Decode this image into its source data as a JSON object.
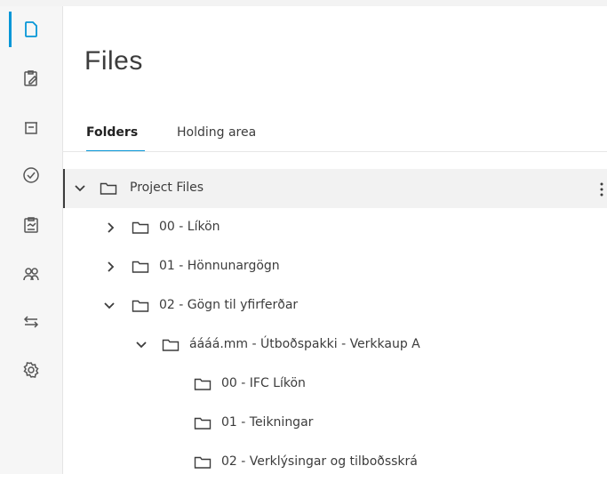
{
  "page": {
    "title": "Files"
  },
  "rail": {
    "items": [
      {
        "icon": "document-icon",
        "active": true
      },
      {
        "icon": "clipboard-edit-icon",
        "active": false
      },
      {
        "icon": "archive-box-icon",
        "active": false
      },
      {
        "icon": "check-circle-icon",
        "active": false
      },
      {
        "icon": "report-clipboard-icon",
        "active": false
      },
      {
        "icon": "members-icon",
        "active": false
      },
      {
        "icon": "transfer-arrows-icon",
        "active": false
      },
      {
        "icon": "settings-gear-icon",
        "active": false
      }
    ]
  },
  "tabs": [
    {
      "label": "Folders",
      "active": true
    },
    {
      "label": "Holding area",
      "active": false
    }
  ],
  "tree": [
    {
      "label": "Project Files",
      "level": 0,
      "state": "expanded",
      "selected": true
    },
    {
      "label": "00 - Líkön",
      "level": 1,
      "state": "collapsed"
    },
    {
      "label": "01 - Hönnunargögn",
      "level": 1,
      "state": "collapsed"
    },
    {
      "label": "02 - Gögn til yfirferðar",
      "level": 1,
      "state": "expanded"
    },
    {
      "label": "áááá.mm - Útboðspakki - Verkkaup A",
      "level": 2,
      "state": "expanded"
    },
    {
      "label": "00 - IFC Líkön",
      "level": 3,
      "state": "leaf"
    },
    {
      "label": "01 - Teikningar",
      "level": 3,
      "state": "leaf"
    },
    {
      "label": "02 - Verklýsingar og tilboðsskrá",
      "level": 3,
      "state": "leaf"
    }
  ],
  "colors": {
    "accent": "#0696d7",
    "rail_bg": "#f6f6f6",
    "selected_row": "#f2f2f2"
  }
}
